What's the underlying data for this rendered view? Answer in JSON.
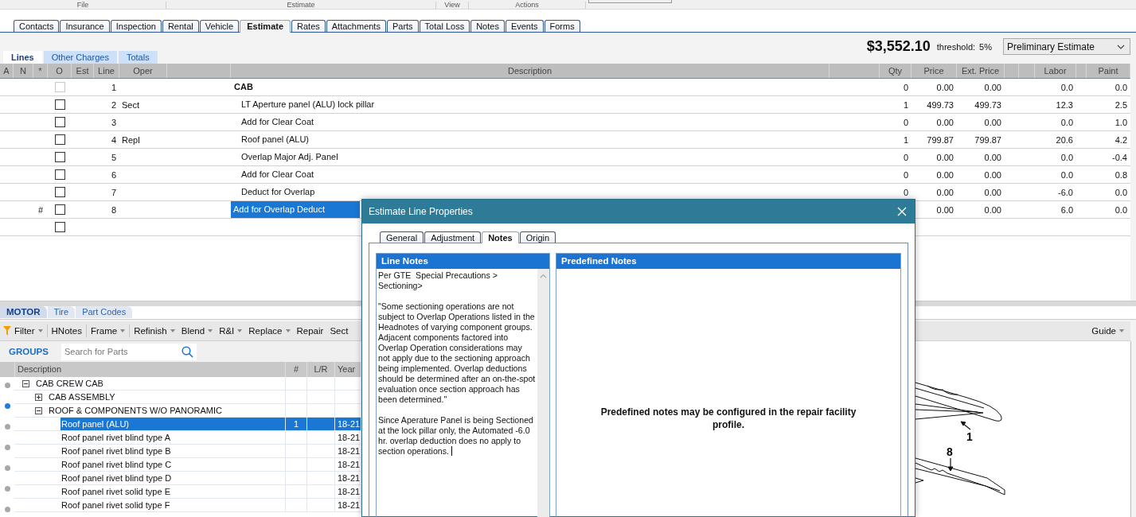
{
  "ribbon": {
    "groups": [
      "File",
      "Estimate",
      "View",
      "Actions"
    ]
  },
  "tabs": [
    {
      "label": "Contacts",
      "selected": false
    },
    {
      "label": "Insurance",
      "selected": false
    },
    {
      "label": "Inspection",
      "selected": false
    },
    {
      "label": "Rental",
      "selected": false
    },
    {
      "label": "Vehicle",
      "selected": false
    },
    {
      "label": "Estimate",
      "selected": true
    },
    {
      "label": "Rates",
      "selected": false
    },
    {
      "label": "Attachments",
      "selected": false
    },
    {
      "label": "Parts",
      "selected": false
    },
    {
      "label": "Total Loss",
      "selected": false
    },
    {
      "label": "Notes",
      "selected": false
    },
    {
      "label": "Events",
      "selected": false
    },
    {
      "label": "Forms",
      "selected": false
    }
  ],
  "lines_tabs": [
    {
      "label": "Lines",
      "selected": true
    },
    {
      "label": "Other Charges",
      "selected": false
    },
    {
      "label": "Totals",
      "selected": false
    }
  ],
  "estimate_total": "$3,552.10",
  "threshold": {
    "label": "threshold:",
    "value": "5%"
  },
  "estimate_type": {
    "value": "Preliminary Estimate"
  },
  "lines_table": {
    "columns": [
      "A",
      "N",
      "*",
      "O",
      "Est",
      "Line",
      "Oper",
      "Description",
      "Qty",
      "Price",
      "Ext. Price",
      "Labor",
      "Paint"
    ],
    "rows": [
      {
        "kind": "header",
        "line": "1",
        "description": "CAB",
        "qty": "0",
        "price": "0.00",
        "ext_price": "0.00",
        "labor": "0.0",
        "paint": "0.0",
        "checked": false,
        "disabled": true,
        "selected": false
      },
      {
        "kind": "line",
        "line": "2",
        "oper": "Sect",
        "description": "LT Aperture panel (ALU) lock pillar",
        "qty": "1",
        "price": "499.73",
        "ext_price": "499.73",
        "labor": "12.3",
        "paint": "2.5",
        "checked": false,
        "disabled": false,
        "selected": false
      },
      {
        "kind": "line",
        "line": "3",
        "description": "Add for Clear Coat",
        "qty": "0",
        "price": "0.00",
        "ext_price": "0.00",
        "labor": "0.0",
        "paint": "1.0",
        "checked": false,
        "disabled": false,
        "selected": false
      },
      {
        "kind": "line",
        "line": "4",
        "oper": "Repl",
        "description": "Roof panel (ALU)",
        "qty": "1",
        "price": "799.87",
        "ext_price": "799.87",
        "labor": "20.6",
        "paint": "4.2",
        "checked": false,
        "disabled": false,
        "selected": false
      },
      {
        "kind": "line",
        "line": "5",
        "description": "Overlap Major Adj. Panel",
        "qty": "0",
        "price": "0.00",
        "ext_price": "0.00",
        "labor": "0.0",
        "paint": "-0.4",
        "checked": false,
        "disabled": false,
        "selected": false
      },
      {
        "kind": "line",
        "line": "6",
        "description": "Add for Clear Coat",
        "qty": "0",
        "price": "0.00",
        "ext_price": "0.00",
        "labor": "0.0",
        "paint": "0.8",
        "checked": false,
        "disabled": false,
        "selected": false
      },
      {
        "kind": "line",
        "line": "7",
        "description": "Deduct for Overlap",
        "qty": "0",
        "price": "0.00",
        "ext_price": "0.00",
        "labor": "-6.0",
        "paint": "0.0",
        "checked": false,
        "disabled": false,
        "selected": false
      },
      {
        "kind": "line",
        "star": "#",
        "line": "8",
        "description": "Add for Overlap Deduct",
        "price": "0.00",
        "ext_price": "0.00",
        "labor": "6.0",
        "paint": "0.0",
        "checked": false,
        "disabled": false,
        "selected": true
      },
      {
        "kind": "blank",
        "checked": false,
        "disabled": false,
        "selected": false
      }
    ]
  },
  "parts_tabs": [
    {
      "label": "MOTOR",
      "selected": true
    },
    {
      "label": "Tire",
      "selected": false
    },
    {
      "label": "Part Codes",
      "selected": false
    }
  ],
  "parts_toolbar": {
    "items": [
      {
        "label": "Filter",
        "kind": "filter",
        "dropdown": true
      },
      {
        "kind": "separator"
      },
      {
        "label": "HNotes",
        "kind": "button",
        "dropdown": false
      },
      {
        "kind": "separator"
      },
      {
        "label": "Frame",
        "kind": "button",
        "dropdown": true
      },
      {
        "kind": "separator"
      },
      {
        "label": "Refinish",
        "kind": "button",
        "dropdown": true
      },
      {
        "label": "Blend",
        "kind": "button",
        "dropdown": true
      },
      {
        "label": "R&I",
        "kind": "button",
        "dropdown": true
      },
      {
        "label": "Replace",
        "kind": "button",
        "dropdown": true
      },
      {
        "label": "Repair",
        "kind": "button",
        "dropdown": false
      },
      {
        "label": "Sect",
        "kind": "button",
        "dropdown": false
      }
    ],
    "guide": {
      "label": "Guide",
      "dropdown": true
    }
  },
  "groups": {
    "title": "GROUPS",
    "search": {
      "placeholder": "Search for Parts"
    }
  },
  "parts_grid": {
    "columns": [
      "Description",
      "#",
      "L/R",
      "Year"
    ],
    "row_markers": [
      {
        "color": "#a8a8a8"
      },
      {
        "color": "#1e7fe0"
      },
      {
        "color": "#a8a8a8"
      },
      {
        "color": "#a8a8a8"
      },
      {
        "color": "#a8a8a8"
      },
      {
        "color": "#a8a8a8"
      },
      {
        "color": "#a8a8a8"
      }
    ],
    "tree": [
      {
        "label": "CAB CREW CAB",
        "expanded": true,
        "selected": false,
        "children": [
          {
            "label": "CAB ASSEMBLY",
            "expanded": false,
            "selected": false
          },
          {
            "label": "ROOF & COMPONENTS W/O PANORAMIC",
            "expanded": true,
            "selected": false,
            "children": [
              {
                "label": "Roof panel (ALU)",
                "number": "1",
                "year": "18-21",
                "selected": true
              },
              {
                "label": "Roof panel rivet blind type A",
                "year": "18-21",
                "selected": false
              },
              {
                "label": "Roof panel rivet blind type B",
                "year": "18-21",
                "selected": false
              },
              {
                "label": "Roof panel rivet blind type C",
                "year": "18-21",
                "selected": false
              },
              {
                "label": "Roof panel rivet blind type D",
                "year": "18-21",
                "selected": false
              },
              {
                "label": "Roof panel rivet solid type E",
                "year": "18-21",
                "selected": false
              },
              {
                "label": "Roof panel rivet solid type F",
                "year": "18-21",
                "selected": false
              }
            ]
          }
        ]
      }
    ]
  },
  "illustration": {
    "callouts": [
      "1",
      "8"
    ]
  },
  "dialog": {
    "title": "Estimate Line Properties",
    "tabs": [
      {
        "label": "General",
        "selected": false
      },
      {
        "label": "Adjustment",
        "selected": false
      },
      {
        "label": "Notes",
        "selected": true
      },
      {
        "label": "Origin",
        "selected": false
      }
    ],
    "line_notes": {
      "title": "Line Notes",
      "text": "Per GTE  Special Precautions >\nSectioning>\n\n\"Some sectioning operations are not subject to Overlap Operations listed in the Headnotes of varying component groups. Adjacent components factored into Overlap Operation considerations may not apply due to the sectioning approach being implemented. Overlap deductions should be determined after an on-the-spot evaluation once section approach has been determined.\"\n\nSince Aperature Panel is being Sectioned at the lock pillar only, the Automated -6.0 hr. overlap deduction does no apply to section operations. "
    },
    "predefined_notes": {
      "title": "Predefined Notes",
      "message": "Predefined notes may be configured in the repair facility profile."
    }
  }
}
